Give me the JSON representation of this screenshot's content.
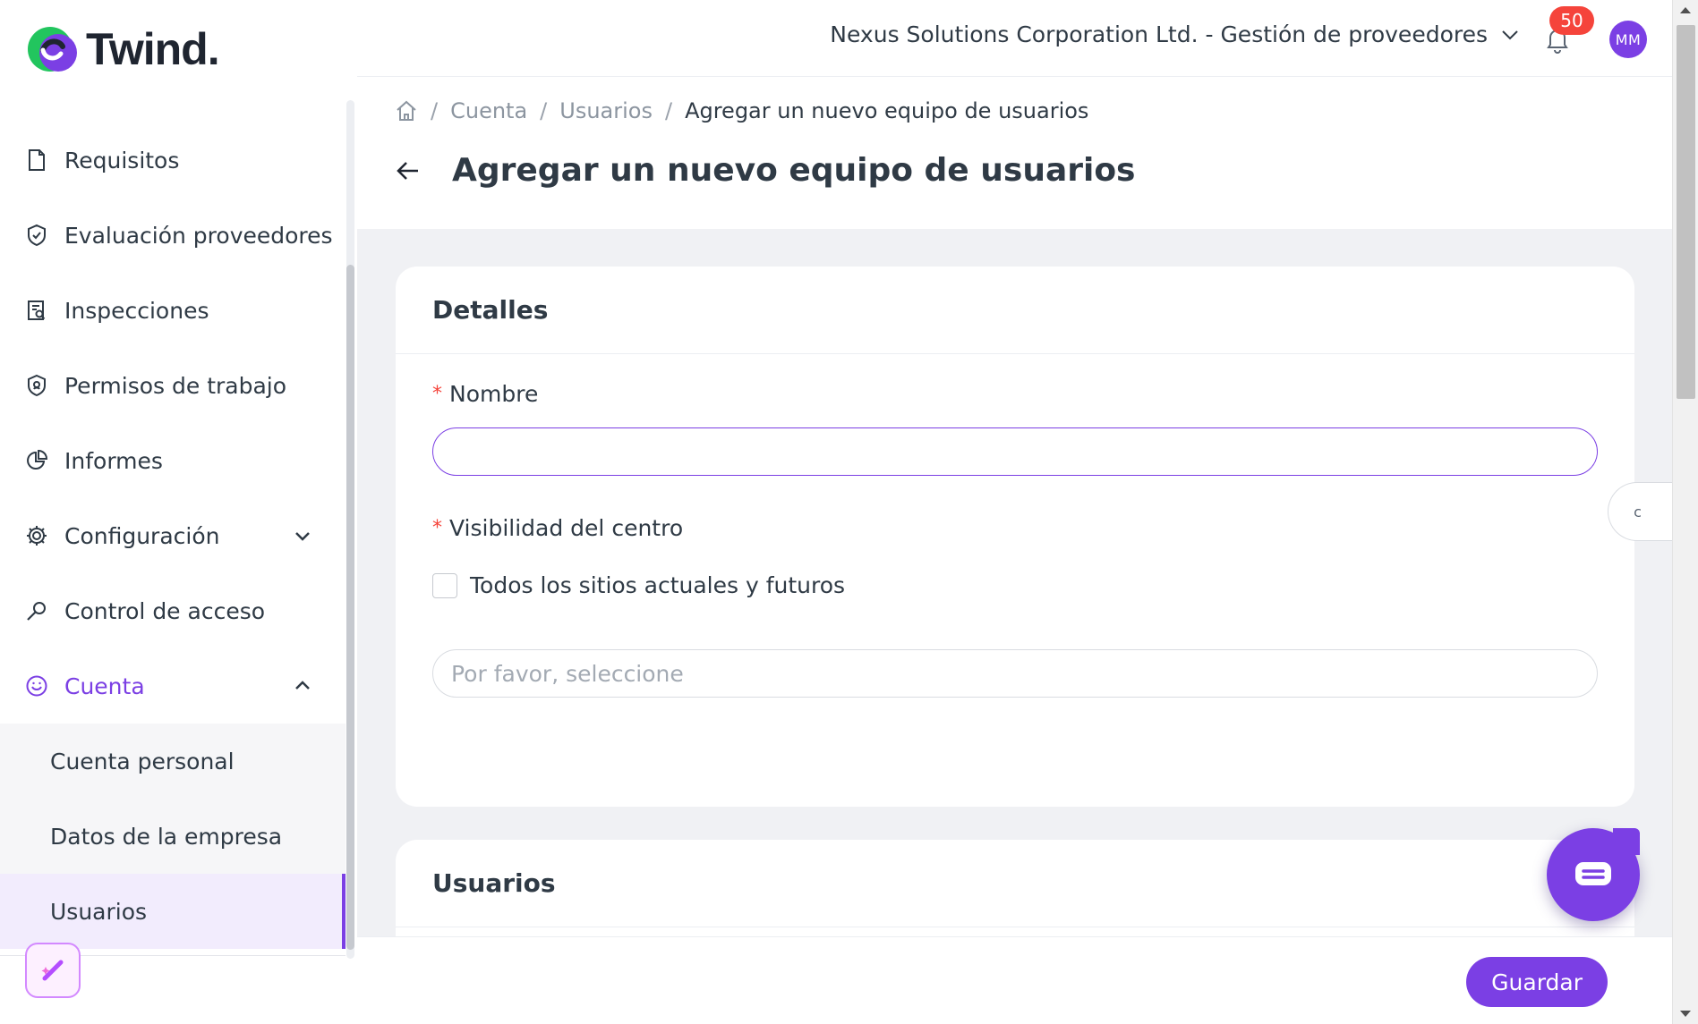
{
  "app": {
    "logo_text": "Twind."
  },
  "sidebar": {
    "items": [
      {
        "label": "Requisitos",
        "icon": "document-icon"
      },
      {
        "label": "Evaluación proveedores",
        "icon": "shield-check-icon"
      },
      {
        "label": "Inspecciones",
        "icon": "clipboard-search-icon"
      },
      {
        "label": "Permisos de trabajo",
        "icon": "shield-badge-icon"
      },
      {
        "label": "Informes",
        "icon": "pie-chart-icon"
      },
      {
        "label": "Configuración",
        "icon": "gear-icon",
        "expandable": true,
        "expanded": false
      },
      {
        "label": "Control de acceso",
        "icon": "key-icon"
      },
      {
        "label": "Cuenta",
        "icon": "smile-icon",
        "expandable": true,
        "expanded": true,
        "active": true
      }
    ],
    "sub_items": [
      {
        "label": "Cuenta personal"
      },
      {
        "label": "Datos de la empresa"
      },
      {
        "label": "Usuarios",
        "selected": true
      }
    ]
  },
  "header": {
    "org_selector": "Nexus Solutions Corporation Ltd. - Gestión de proveedores",
    "notification_count": "50",
    "avatar_initials": "MM"
  },
  "breadcrumb": {
    "items": [
      "Cuenta",
      "Usuarios"
    ],
    "current": "Agregar un nuevo equipo de usuarios",
    "separator": "/"
  },
  "page": {
    "title": "Agregar un nuevo equipo de usuarios"
  },
  "details_card": {
    "title": "Detalles",
    "name_label": "Nombre",
    "name_value": "",
    "visibility_label": "Visibilidad del centro",
    "checkbox_label": "Todos los sitios actuales y futuros",
    "checkbox_checked": false,
    "select_placeholder": "Por favor, seleccione",
    "required_mark": "*"
  },
  "users_card": {
    "title": "Usuarios"
  },
  "side_tab": {
    "label": "c"
  },
  "footer": {
    "save_label": "Guardar"
  },
  "colors": {
    "accent": "#7b3fe4",
    "badge": "#f5443b",
    "logo_green": "#22c55e",
    "logo_purple": "#7b3fe4"
  }
}
